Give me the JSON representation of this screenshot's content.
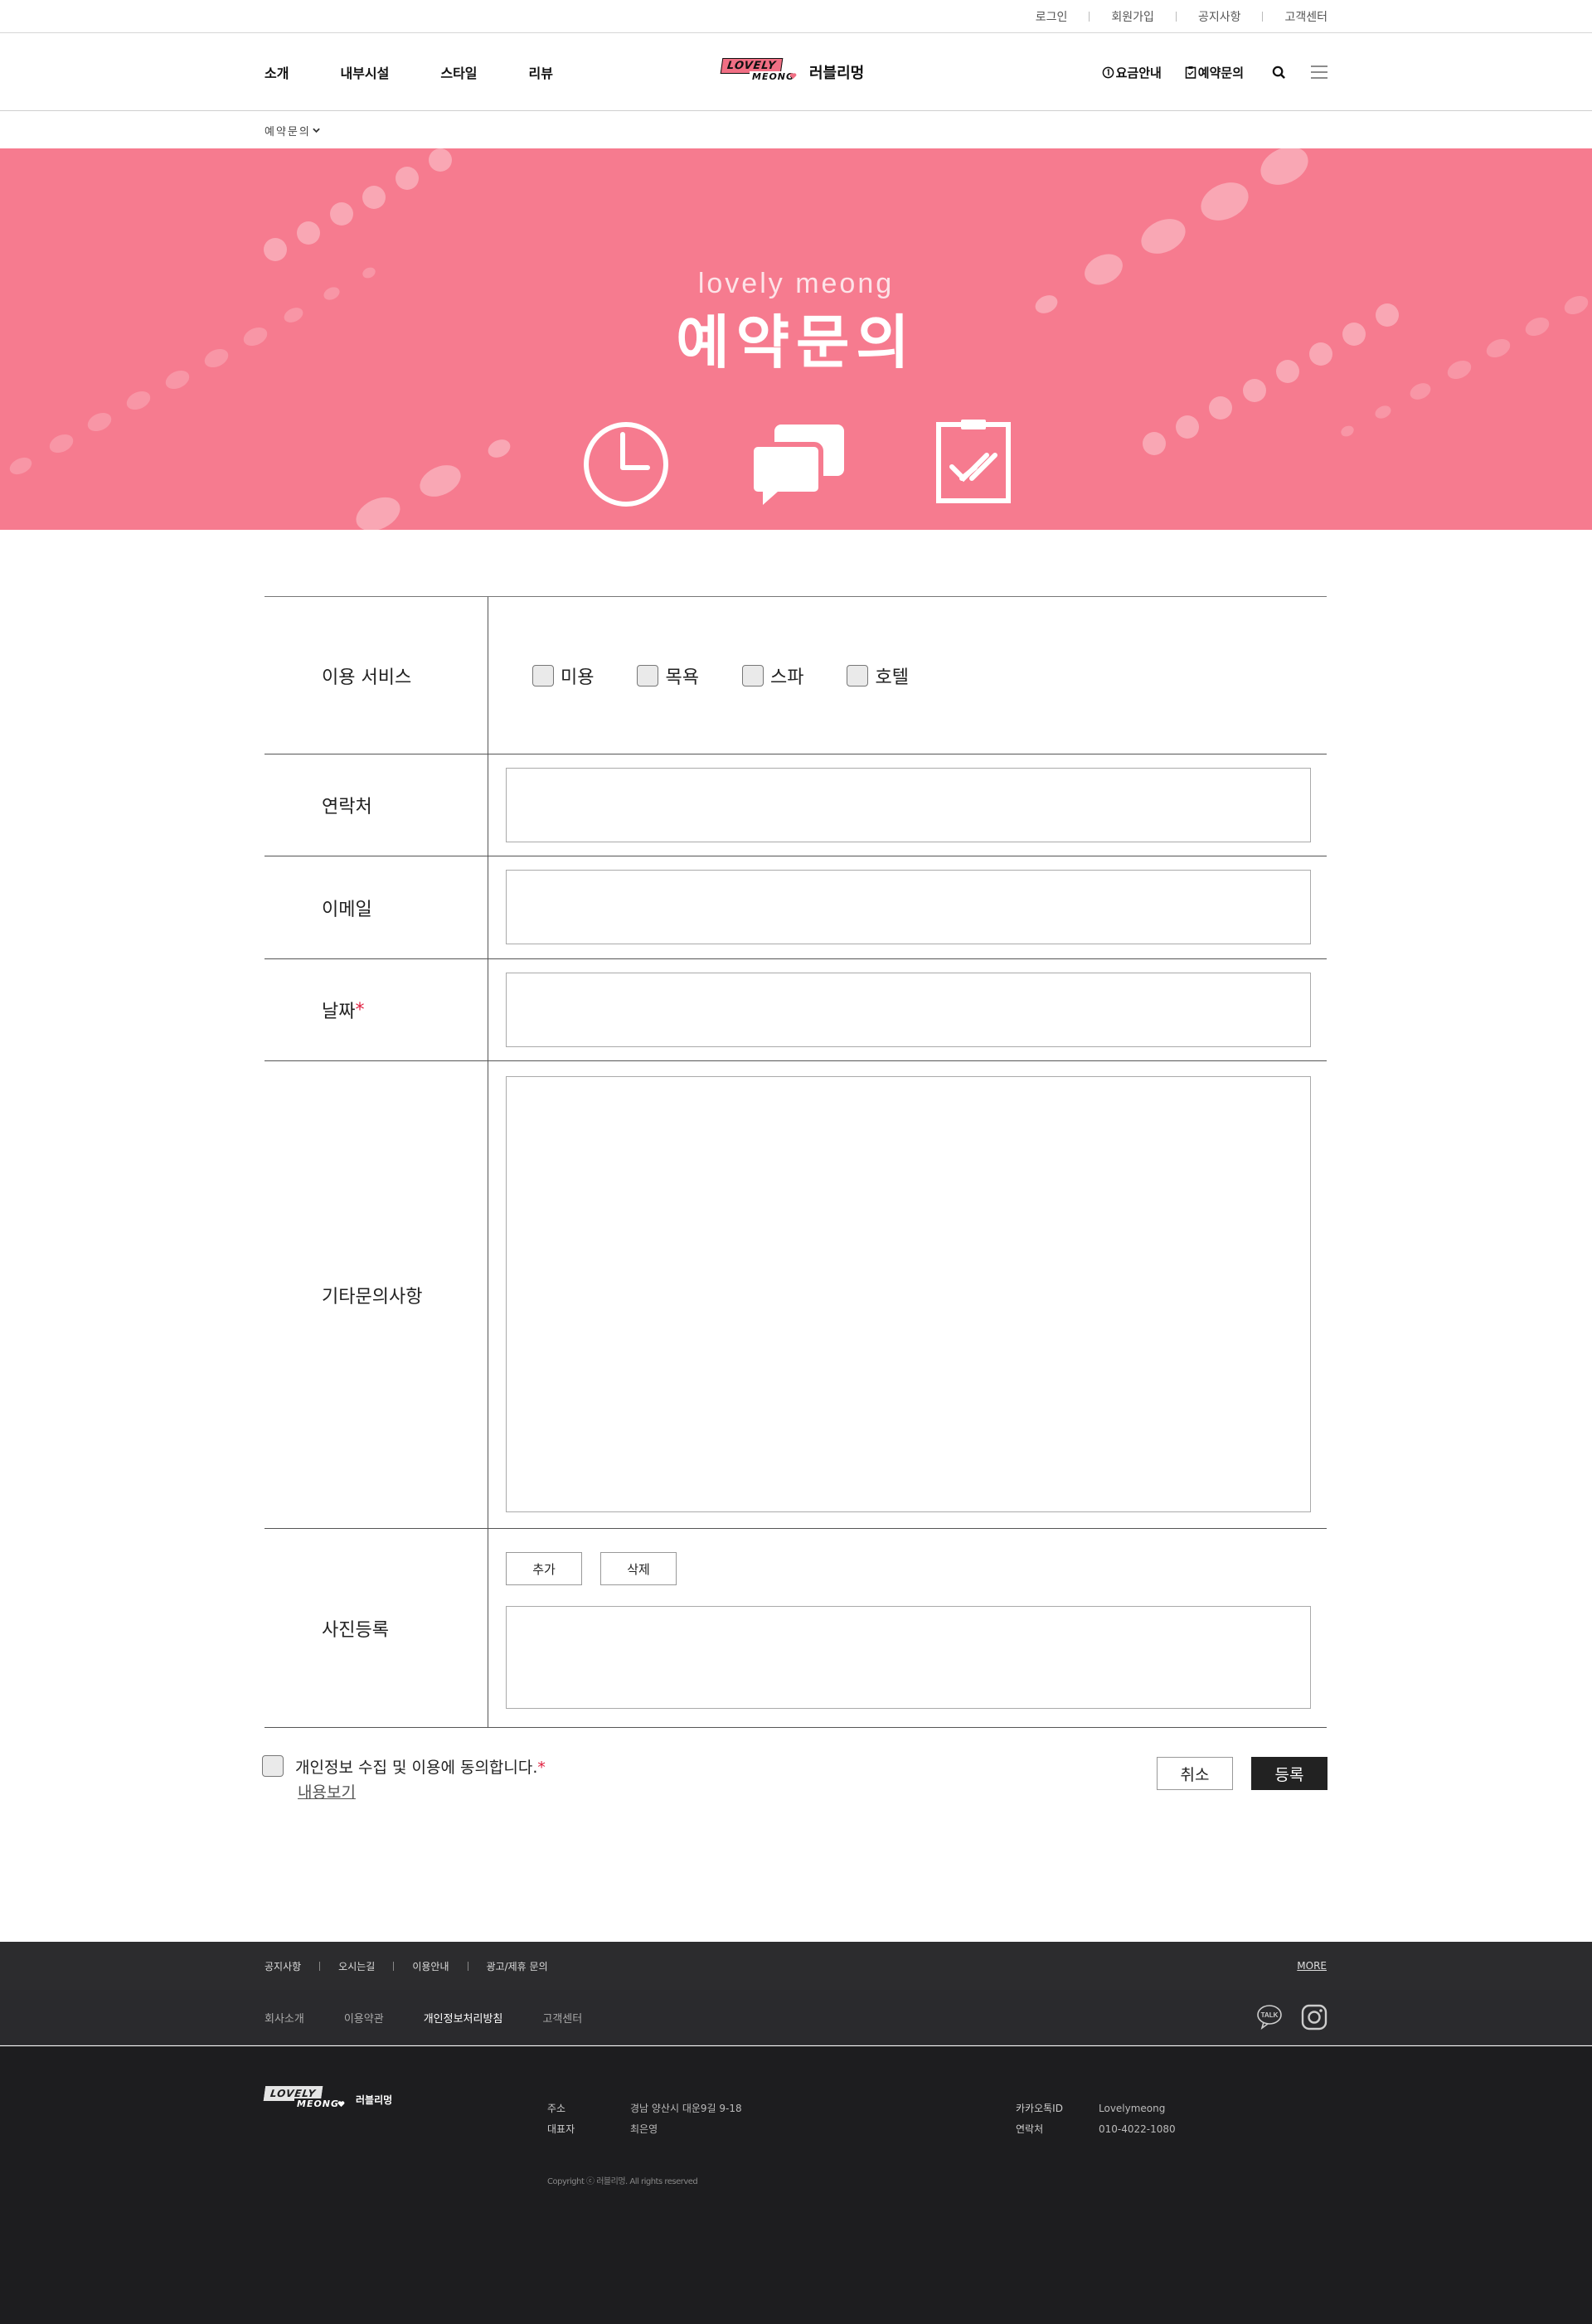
{
  "top_links": [
    "로그인",
    "회원가입",
    "공지사항",
    "고객센터"
  ],
  "nav": {
    "items": [
      "소개",
      "내부시설",
      "스타일",
      "리뷰"
    ]
  },
  "brand": {
    "logo_line1": "LOVELY",
    "logo_line2": "MEONG",
    "name": "러블리멍"
  },
  "header_buttons": {
    "pricing": "요금안내",
    "reservation": "예약문의"
  },
  "breadcrumb": "예약문의",
  "hero": {
    "subtitle": "lovely meong",
    "title": "예약문의"
  },
  "form": {
    "service_label": "이용 서비스",
    "services": [
      "미용",
      "목욕",
      "스파",
      "호텔"
    ],
    "contact_label": "연락처",
    "email_label": "이메일",
    "date_label": "날짜",
    "required_mark": "*",
    "etc_label": "기타문의사항",
    "photo_label": "사진등록",
    "add_label": "추가",
    "delete_label": "삭제"
  },
  "agreement": {
    "text": "개인정보 수집 및 이용에 동의합니다.",
    "view_link": "내용보기"
  },
  "actions": {
    "cancel": "취소",
    "submit": "등록"
  },
  "footer": {
    "links_row1": [
      "공지사항",
      "오시는길",
      "이용안내",
      "광고/제휴 문의"
    ],
    "more": "MORE",
    "links_row2": [
      "회사소개",
      "이용약관",
      "개인정보처리방침",
      "고객센터"
    ],
    "talk_icon_label": "TALK",
    "address_label": "주소",
    "address": "경남 양산시 대운9길 9-18",
    "ceo_label": "대표자",
    "ceo": "최은영",
    "kakao_label": "카카오톡ID",
    "kakao": "Lovelymeong",
    "phone_label": "연락처",
    "phone": "010-4022-1080",
    "copyright": "Copyright ⓒ 러블리멍. All rights reserved"
  },
  "colors": {
    "hero_bg": "#f67b8f",
    "required": "#e02040",
    "footer_bg": "#1d1d1f",
    "submit_bg": "#222222"
  }
}
